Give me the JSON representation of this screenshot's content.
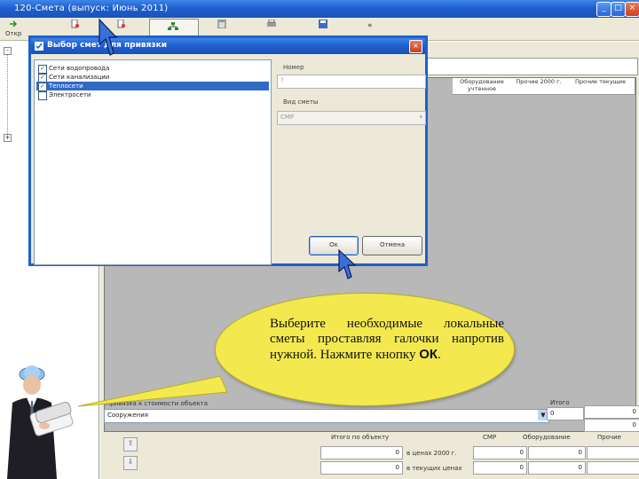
{
  "window": {
    "title": "120-Смета (выпуск: Июнь 2011)",
    "minimize_glyph": "_",
    "maximize_glyph": "□",
    "close_glyph": "×"
  },
  "toolbar": {
    "open_label": "Откр",
    "ribbon_collapse_glyph": "«"
  },
  "dialog": {
    "title": "Выбор смет для привязки",
    "close_glyph": "×",
    "items": [
      {
        "label": "Сети водопровода",
        "checked": true,
        "selected": false
      },
      {
        "label": "Сети канализации",
        "checked": true,
        "selected": false
      },
      {
        "label": "Теплосети",
        "checked": true,
        "selected": true
      },
      {
        "label": "Электросети",
        "checked": false,
        "selected": false
      }
    ],
    "check_glyph": "✓",
    "number_label": "Номер",
    "number_placeholder": "?",
    "estimate_type_label": "Вид сметы",
    "estimate_type_value": "СМР",
    "ok_label": "Ок",
    "cancel_label": "Отмена"
  },
  "grid": {
    "headers": [
      "Оборудование учтенное",
      "Прочие 2000 г.",
      "Прочие текущие"
    ]
  },
  "bottom": {
    "link_label": "Привязка к стоимости объекта",
    "link_value": "Сооружения",
    "total_label": "Итого",
    "total_value": "0",
    "object_total_label": "Итого по объекту",
    "col_smr": "СМР",
    "col_equipment": "Оборудование",
    "col_other": "Прочие",
    "row_2000": "в ценах 2000 г.",
    "row_current": "в текущих ценах",
    "zero": "0",
    "side_values": [
      "0",
      "0"
    ]
  },
  "callout": {
    "text_main": "Выберите необходимые локальные сметы проставляя галочки напротив нужной. Нажмите кнопку",
    "text_bold": "ОК",
    "text_end": "."
  },
  "colors": {
    "titlebar": "#1f5fcf",
    "selection": "#316ac5",
    "callout": "#f3e94f"
  }
}
